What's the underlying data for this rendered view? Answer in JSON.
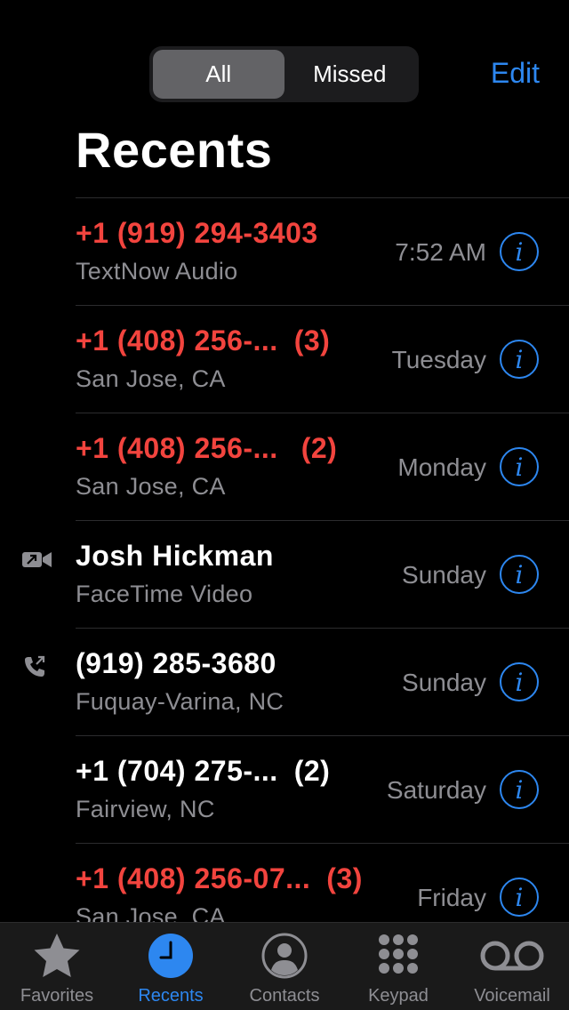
{
  "header": {
    "segments": [
      "All",
      "Missed"
    ],
    "active_segment": "All",
    "edit_label": "Edit",
    "title": "Recents"
  },
  "calls": [
    {
      "name": "+1 (919) 294-3403",
      "count": "",
      "subtitle": "TextNow Audio",
      "time": "7:52 AM",
      "missed": true,
      "icon": ""
    },
    {
      "name": "+1 (408) 256-...",
      "count": "(3)",
      "subtitle": "San Jose, CA",
      "time": "Tuesday",
      "missed": true,
      "icon": ""
    },
    {
      "name": "+1 (408) 256-...",
      "count": "(2)",
      "subtitle": "San Jose, CA",
      "time": "Monday",
      "missed": true,
      "icon": ""
    },
    {
      "name": "Josh Hickman",
      "count": "",
      "subtitle": "FaceTime Video",
      "time": "Sunday",
      "missed": false,
      "icon": "outgoing-video-icon"
    },
    {
      "name": "(919) 285-3680",
      "count": "",
      "subtitle": "Fuquay-Varina, NC",
      "time": "Sunday",
      "missed": false,
      "icon": "outgoing-call-icon"
    },
    {
      "name": "+1 (704) 275-...",
      "count": "(2)",
      "subtitle": "Fairview, NC",
      "time": "Saturday",
      "missed": false,
      "icon": ""
    },
    {
      "name": "+1 (408) 256-07...",
      "count": "(3)",
      "subtitle": "San Jose, CA",
      "time": "Friday",
      "missed": true,
      "icon": ""
    }
  ],
  "info_glyph": "i",
  "tabs": [
    {
      "label": "Favorites",
      "icon": "star-icon"
    },
    {
      "label": "Recents",
      "icon": "clock-icon"
    },
    {
      "label": "Contacts",
      "icon": "person-circle-icon"
    },
    {
      "label": "Keypad",
      "icon": "keypad-icon"
    },
    {
      "label": "Voicemail",
      "icon": "voicemail-icon"
    }
  ],
  "active_tab": "Recents",
  "colors": {
    "accent": "#2d87f0",
    "missed": "#f2443e",
    "secondary": "#8e8e93"
  }
}
